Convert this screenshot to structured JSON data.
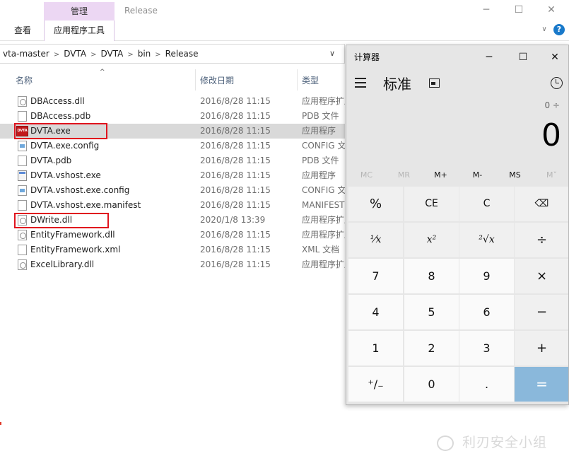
{
  "explorer": {
    "ribbon": {
      "manage_tab": "管理",
      "tools_tab": "应用程序工具",
      "view_tab": "查看",
      "window_title": "Release",
      "minimize": "─",
      "maximize": "☐",
      "close": "✕",
      "chevron": "∨",
      "help": "?"
    },
    "address": {
      "crumbs": [
        "vta-master",
        "DVTA",
        "DVTA",
        "bin",
        "Release"
      ],
      "separator": ">",
      "dropdown": "∨"
    },
    "columns": {
      "sort_arrow": "^",
      "name": "名称",
      "date": "修改日期",
      "type": "类型"
    },
    "files": [
      {
        "name": "DBAccess.dll",
        "date": "2016/8/28 11:15",
        "type": "应用程序扩展",
        "icon": "dll-icon"
      },
      {
        "name": "DBAccess.pdb",
        "date": "2016/8/28 11:15",
        "type": "PDB 文件",
        "icon": "pdb-icon"
      },
      {
        "name": "DVTA.exe",
        "date": "2016/8/28 11:15",
        "type": "应用程序",
        "icon": "dvta-app-icon"
      },
      {
        "name": "DVTA.exe.config",
        "date": "2016/8/28 11:15",
        "type": "CONFIG 文件",
        "icon": "config-icon"
      },
      {
        "name": "DVTA.pdb",
        "date": "2016/8/28 11:15",
        "type": "PDB 文件",
        "icon": "pdb-icon"
      },
      {
        "name": "DVTA.vshost.exe",
        "date": "2016/8/28 11:15",
        "type": "应用程序",
        "icon": "exe-icon"
      },
      {
        "name": "DVTA.vshost.exe.config",
        "date": "2016/8/28 11:15",
        "type": "CONFIG 文件",
        "icon": "config-icon"
      },
      {
        "name": "DVTA.vshost.exe.manifest",
        "date": "2016/8/28 11:15",
        "type": "MANIFEST 文件",
        "icon": "manifest-icon"
      },
      {
        "name": "DWrite.dll",
        "date": "2020/1/8 13:39",
        "type": "应用程序扩展",
        "icon": "dll-icon"
      },
      {
        "name": "EntityFramework.dll",
        "date": "2016/8/28 11:15",
        "type": "应用程序扩展",
        "icon": "dll-icon"
      },
      {
        "name": "EntityFramework.xml",
        "date": "2016/8/28 11:15",
        "type": "XML 文档",
        "icon": "xml-icon"
      },
      {
        "name": "ExcelLibrary.dll",
        "date": "2016/8/28 11:15",
        "type": "应用程序扩展",
        "icon": "dll-icon"
      }
    ],
    "dvta_icon_text": "DVTA"
  },
  "calculator": {
    "title": "计算器",
    "minimize": "─",
    "maximize": "☐",
    "close": "✕",
    "mode": "标准",
    "expression": "0 ÷",
    "display": "0",
    "memory": [
      {
        "label": "MC",
        "enabled": false
      },
      {
        "label": "MR",
        "enabled": false
      },
      {
        "label": "M+",
        "enabled": true
      },
      {
        "label": "M-",
        "enabled": true
      },
      {
        "label": "MS",
        "enabled": true
      },
      {
        "label": "M˅",
        "enabled": false
      }
    ],
    "keys": {
      "percent": "%",
      "ce": "CE",
      "c": "C",
      "backspace": "⌫",
      "reciprocal": "⅟x",
      "square": "x²",
      "sqrt": "²√x",
      "divide": "÷",
      "seven": "7",
      "eight": "8",
      "nine": "9",
      "multiply": "×",
      "four": "4",
      "five": "5",
      "six": "6",
      "minus": "−",
      "one": "1",
      "two": "2",
      "three": "3",
      "plus": "+",
      "negate": "⁺∕₋",
      "zero": "0",
      "decimal": ".",
      "equals": "="
    },
    "colors": {
      "background": "#e6e6e6",
      "equals_key": "#8ab8db"
    }
  },
  "watermark": {
    "text": "利刃安全小组"
  },
  "colors": {
    "manage_tab": "#ecd7f3",
    "selection": "#d9d9d9",
    "highlight": "#e0141e",
    "help_icon": "#1979ca"
  }
}
